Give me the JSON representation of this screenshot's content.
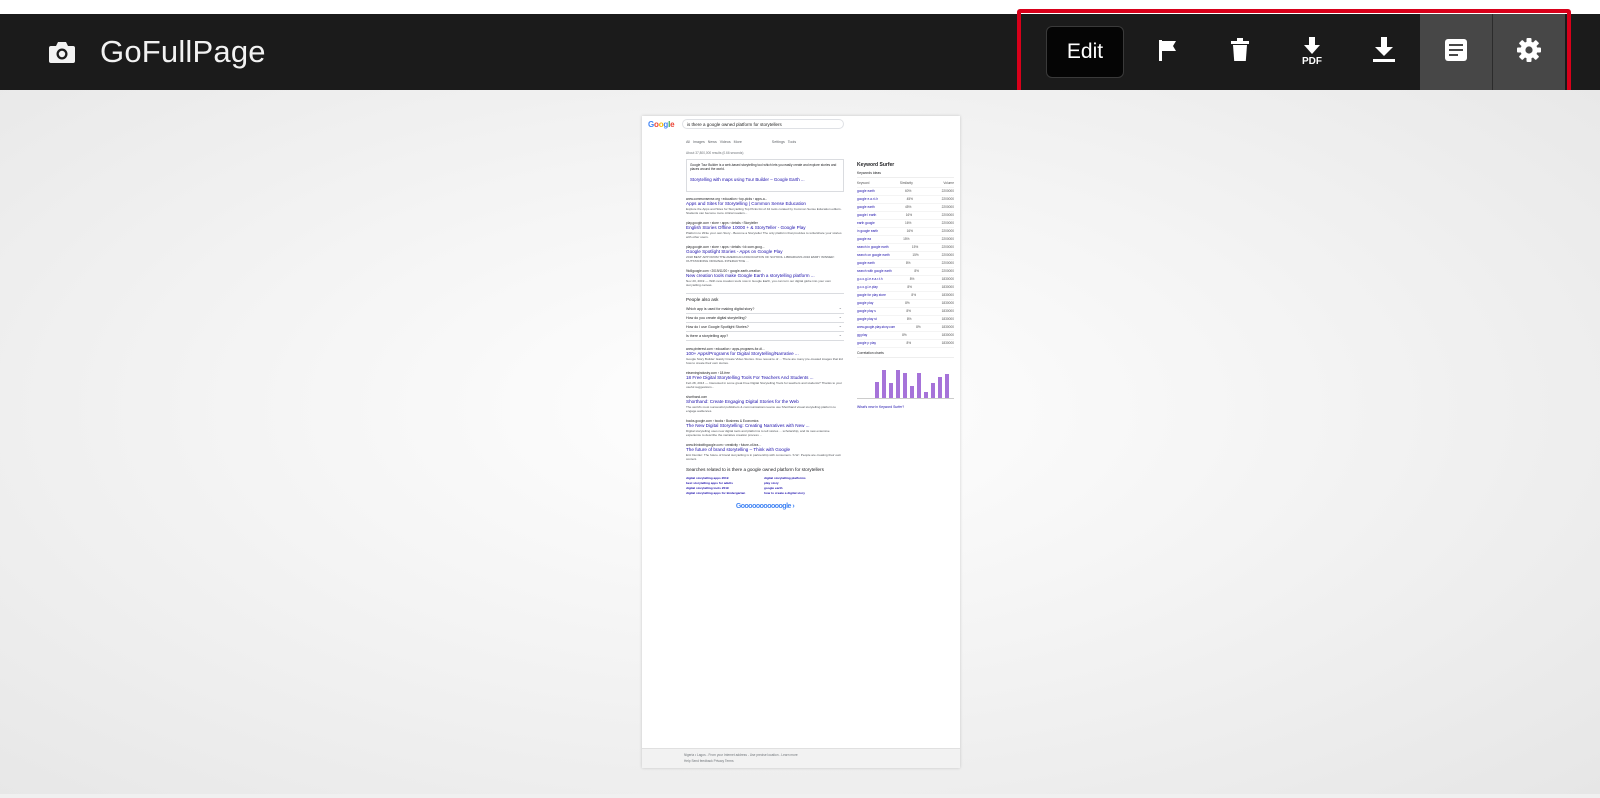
{
  "app": {
    "title": "GoFullPage"
  },
  "toolbar": {
    "edit_label": "Edit",
    "buttons": [
      {
        "name": "flag-button",
        "icon": "flag-icon"
      },
      {
        "name": "delete-button",
        "icon": "trash-icon"
      },
      {
        "name": "download-pdf-button",
        "icon": "download-pdf-icon",
        "label": "PDF"
      },
      {
        "name": "download-image-button",
        "icon": "download-icon"
      },
      {
        "name": "file-list-button",
        "icon": "document-icon",
        "active": true
      },
      {
        "name": "settings-button",
        "icon": "gear-icon",
        "active": true
      }
    ]
  },
  "colors": {
    "header_bg": "#1b1b1b",
    "highlight_border": "#d8001a",
    "active_button_bg": "#474747"
  },
  "capture": {
    "search_query": "is there a google owned platform for storytellers",
    "tabs": "All   Images   News   Videos   More                              Settings   Tools",
    "stats": "About 37,800,000 results (0.66 seconds)",
    "snippet_text": "Google Tour Builder is a web-based storytelling tool which lets you easily create and explore stories and places around the world.",
    "snippet_link": "Storytelling with maps using Tour Builder – Google Earth ...",
    "results": [
      {
        "url": "www.commonsense.org › education › top-picks › apps-a...",
        "title": "Apps and Sites for Storytelling | Common Sense Education",
        "snippet": "Explore the Apps and Sites for Storytelling Top Picks list of 42 tools curated by Common Sense Education editors. Students can become more critical readers..."
      },
      {
        "url": "play.google.com › store › apps › details › Storyteller",
        "title": "English Stories Offline 10000 + & StoryTeller - Google Play",
        "snippet": "Platform to Write your own Story - Become a Storyteller The only platform that provides to write/share your stories with other users."
      },
      {
        "url": "play.google.com › store › apps › details › id=com.goog...",
        "title": "Google Spotlight Stories - Apps on Google Play",
        "snippet": "2018 BEST APP FROM THE AMERICAN ASSOCIATION OF SCHOOL LIBRARIANS 2016 EMMY WINNER: OUTSTANDING ORIGINAL INTERACTIVE ..."
      },
      {
        "url": "9to5google.com › 2019/11/20 › google-earth-creation",
        "title": "New creation tools make Google Earth a storytelling platform ...",
        "snippet": "Nov 20, 2019 — With new creation tools now in Google Earth, you can turn our digital globe into your own storytelling canvas."
      }
    ],
    "paa_heading": "People also ask",
    "paa_questions": [
      "Which app is used for making digital story?",
      "How do you create digital storytelling?",
      "How do I use Google Spotlight Stories?",
      "Is there a storytelling app?"
    ],
    "results2": [
      {
        "url": "www.pinterest.com › education › apps-programs-for-di...",
        "title": "100+ Apps/Programs for Digital Storytelling/Narrative ...",
        "snippet": "Google Story Builder: Easily Create Video Stories. Free resource of ... There are many pre-created images that kid how to create their own stories."
      },
      {
        "url": "elearningindustry.com › 18-free",
        "title": "18 Free Digital Storytelling Tools For Teachers And Students ...",
        "snippet": "Feb 28, 2013 — Interested in some great Free Digital Storytelling Tools for teachers and students? Thanks to your useful suggestions..."
      },
      {
        "url": "shorthand.com",
        "title": "Shorthand: Create Engaging Digital Stories for the Web",
        "snippet": "The world's most successful publishers & communications teams use Shorthand visual storytelling platform to engage audiences."
      },
      {
        "url": "books.google.com › books › Business & Economics",
        "title": "The New Digital Storytelling: Creating Narratives with New ...",
        "snippet": "Digital storytelling uses new digital tools and platforms to tell stories ... scholarship, and its new extensive experience to describe the narrative creation process ..."
      },
      {
        "url": "www.thinkwithgoogle.com › creativity › future-of-bra...",
        "title": "The future of brand storytelling – Think with Google",
        "snippet": "Eric Dentler: The future of brand storytelling is in partnership with consumers. S.W.: People are creating their own content."
      }
    ],
    "related_heading": "Searches related to is there a google owned platform for storytellers",
    "related": [
      "digital storytelling apps 2019",
      "digital storytelling platforms",
      "best storytelling apps for adults",
      "play story",
      "digital storytelling tools 2019",
      "google earth",
      "digital storytelling apps for kindergarten",
      "how to create a digital story"
    ],
    "pager": "Gooooooooooogle  ›",
    "footer_lines": [
      "Nigeria   •  Lagos - From your Internet address - Use precise location - Learn more",
      "Help    Send feedback    Privacy    Terms"
    ],
    "keyword_surfer": {
      "title": "Keyword Surfer",
      "ideas_heading": "Keywords ideas",
      "columns": [
        "Keyword",
        "Similarity",
        "Volume"
      ],
      "rows": [
        [
          "google earth",
          "60%",
          "2200000"
        ],
        [
          "google e.a.r.t.h",
          "45%",
          "2200000"
        ],
        [
          "google earth",
          "45%",
          "2200000"
        ],
        [
          "google i earth",
          "16%",
          "2200000"
        ],
        [
          "earth google",
          "16%",
          "2200000"
        ],
        [
          "in google earth",
          "16%",
          "2200000"
        ],
        [
          "google ea",
          "15%",
          "2200000"
        ],
        [
          "search in google earth",
          "15%",
          "2200000"
        ],
        [
          "search on google earth",
          "15%",
          "2200000"
        ],
        [
          "google earth",
          "8%",
          "2200000"
        ],
        [
          "search with google earth",
          "8%",
          "2200000"
        ],
        [
          "g.o.o.g.l.e.e.a.r.t.h",
          "8%",
          "1830000"
        ],
        [
          "g.o.o.g.l.e.play",
          "8%",
          "1830000"
        ],
        [
          "google for play store",
          "8%",
          "1830000"
        ],
        [
          "google play",
          "8%",
          "1830000"
        ],
        [
          "google play s",
          "8%",
          "1830000"
        ],
        [
          "google play st",
          "8%",
          "1830000"
        ],
        [
          "www.google.play.story.com",
          "8%",
          "1830000"
        ],
        [
          "gg play",
          "8%",
          "1830000"
        ],
        [
          "google p play",
          "8%",
          "1830000"
        ]
      ],
      "chart_heading": "Correlation charts",
      "bar_levels": [
        0.55,
        0.95,
        0.5,
        0.95,
        0.85,
        0.4,
        0.85,
        0.2,
        0.5,
        0.7,
        0.8
      ],
      "footer_link": "What's new in Keyword Surfer?"
    }
  }
}
